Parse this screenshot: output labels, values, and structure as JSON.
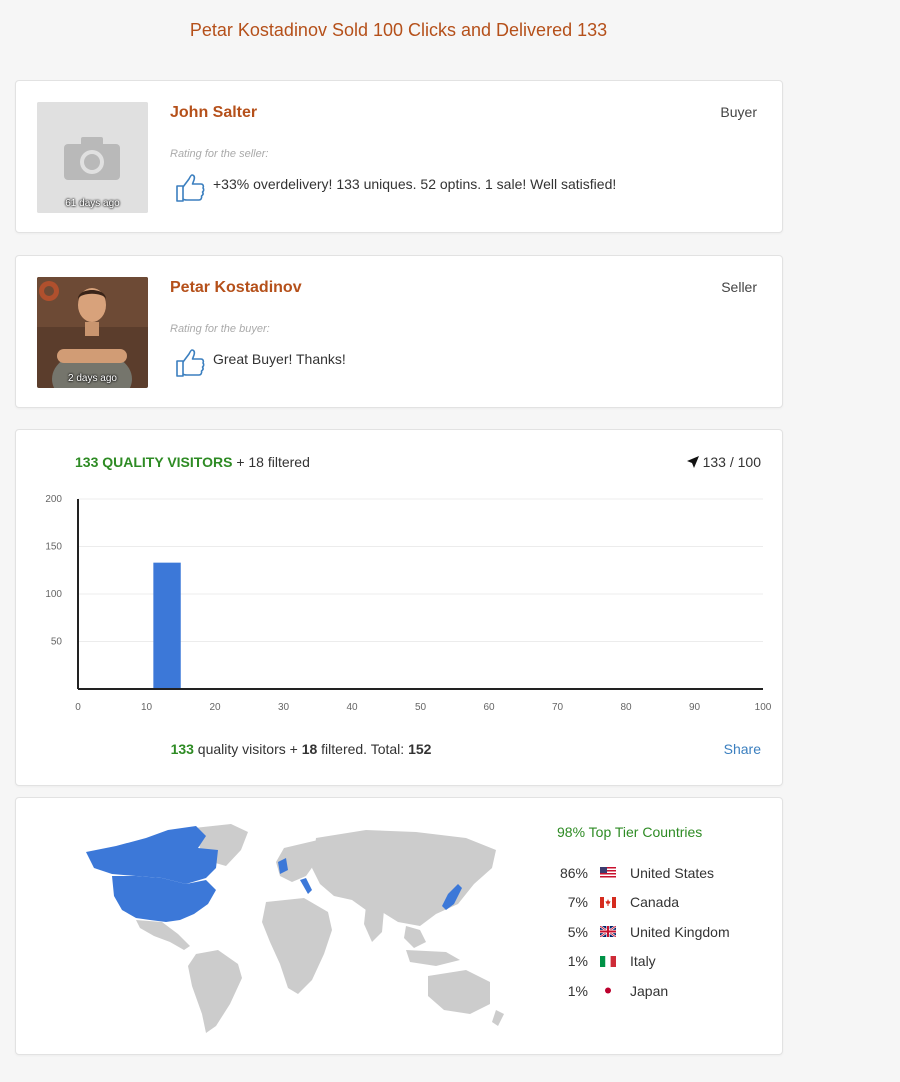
{
  "page": {
    "title": "Petar Kostadinov Sold 100 Clicks and Delivered 133"
  },
  "reviews": [
    {
      "name": "John Salter",
      "role": "Buyer",
      "rating_label": "Rating for the seller:",
      "comment": "+33% overdelivery! 133 uniques. 52 optins. 1 sale! Well satisfied!",
      "days_ago": "61 days ago",
      "photo": "camera-placeholder-icon"
    },
    {
      "name": "Petar Kostadinov",
      "role": "Seller",
      "rating_label": "Rating for the buyer:",
      "comment": "Great Buyer! Thanks!",
      "days_ago": "2 days ago",
      "photo": "user-photo"
    }
  ],
  "visitors": {
    "header_quality": "133 QUALITY VISITORS",
    "header_filtered": "+ 18 filtered",
    "delivered_ratio": "133 / 100",
    "footer": {
      "quality_count": "133",
      "quality_text": " quality visitors + ",
      "filtered_count": "18",
      "filtered_text": " filtered. Total: ",
      "total": "152"
    },
    "share_label": "Share"
  },
  "chart_data": {
    "type": "bar",
    "x_ticks": [
      0,
      10,
      20,
      30,
      40,
      50,
      60,
      70,
      80,
      90,
      100
    ],
    "y_ticks": [
      50,
      100,
      150,
      200
    ],
    "xlim": [
      0,
      100
    ],
    "ylim": [
      0,
      200
    ],
    "bars": [
      {
        "x_start": 11,
        "x_end": 15,
        "value": 133
      }
    ],
    "bar_color": "#3c78d8",
    "grid": true
  },
  "geo": {
    "top_tier_label": "98% Top Tier Countries",
    "countries": [
      {
        "pct": "86%",
        "name": "United States",
        "flag": "us-flag-icon"
      },
      {
        "pct": "7%",
        "name": "Canada",
        "flag": "canada-flag-icon"
      },
      {
        "pct": "5%",
        "name": "United Kingdom",
        "flag": "uk-flag-icon"
      },
      {
        "pct": "1%",
        "name": "Italy",
        "flag": "italy-flag-icon"
      },
      {
        "pct": "1%",
        "name": "Japan",
        "flag": "japan-flag-icon"
      }
    ],
    "highlight_color": "#3c78d8",
    "base_color": "#cccccc"
  }
}
